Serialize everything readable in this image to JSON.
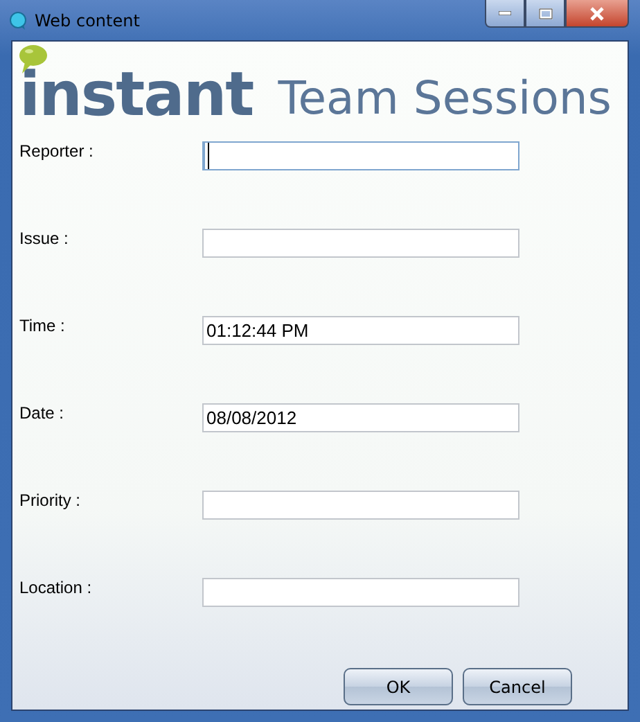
{
  "window": {
    "title": "Web content"
  },
  "logo": {
    "brand": "instant",
    "product": "Team Sessions"
  },
  "fields": [
    {
      "label": "Reporter :",
      "focused": true
    },
    {
      "label": "Issue :",
      "focused": false
    },
    {
      "label": "Time :",
      "value": "01:12:44 PM",
      "focused": false
    },
    {
      "label": "Date :",
      "value": "08/08/2012",
      "focused": false
    },
    {
      "label": "Priority :",
      "focused": false
    },
    {
      "label": "Location :",
      "focused": false
    }
  ],
  "buttons": [
    "OK",
    "Cancel"
  ]
}
